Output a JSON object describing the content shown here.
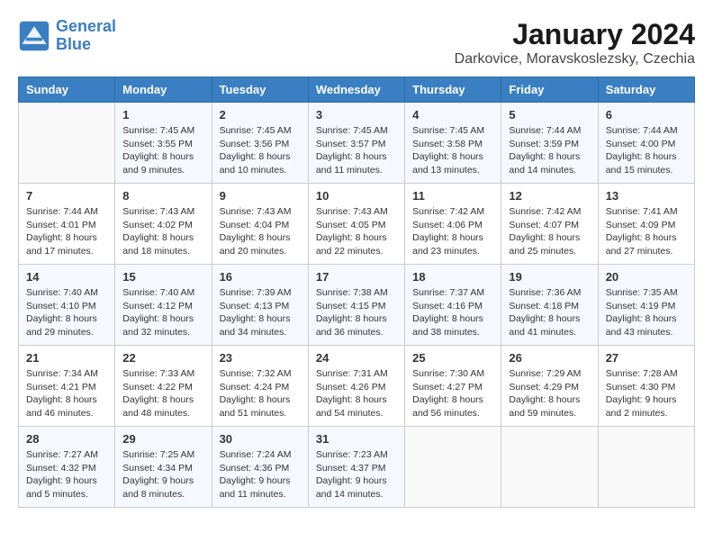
{
  "logo": {
    "line1": "General",
    "line2": "Blue"
  },
  "title": "January 2024",
  "subtitle": "Darkovice, Moravskoslezsky, Czechia",
  "weekdays": [
    "Sunday",
    "Monday",
    "Tuesday",
    "Wednesday",
    "Thursday",
    "Friday",
    "Saturday"
  ],
  "weeks": [
    [
      {
        "day": "",
        "info": ""
      },
      {
        "day": "1",
        "info": "Sunrise: 7:45 AM\nSunset: 3:55 PM\nDaylight: 8 hours\nand 9 minutes."
      },
      {
        "day": "2",
        "info": "Sunrise: 7:45 AM\nSunset: 3:56 PM\nDaylight: 8 hours\nand 10 minutes."
      },
      {
        "day": "3",
        "info": "Sunrise: 7:45 AM\nSunset: 3:57 PM\nDaylight: 8 hours\nand 11 minutes."
      },
      {
        "day": "4",
        "info": "Sunrise: 7:45 AM\nSunset: 3:58 PM\nDaylight: 8 hours\nand 13 minutes."
      },
      {
        "day": "5",
        "info": "Sunrise: 7:44 AM\nSunset: 3:59 PM\nDaylight: 8 hours\nand 14 minutes."
      },
      {
        "day": "6",
        "info": "Sunrise: 7:44 AM\nSunset: 4:00 PM\nDaylight: 8 hours\nand 15 minutes."
      }
    ],
    [
      {
        "day": "7",
        "info": "Sunrise: 7:44 AM\nSunset: 4:01 PM\nDaylight: 8 hours\nand 17 minutes."
      },
      {
        "day": "8",
        "info": "Sunrise: 7:43 AM\nSunset: 4:02 PM\nDaylight: 8 hours\nand 18 minutes."
      },
      {
        "day": "9",
        "info": "Sunrise: 7:43 AM\nSunset: 4:04 PM\nDaylight: 8 hours\nand 20 minutes."
      },
      {
        "day": "10",
        "info": "Sunrise: 7:43 AM\nSunset: 4:05 PM\nDaylight: 8 hours\nand 22 minutes."
      },
      {
        "day": "11",
        "info": "Sunrise: 7:42 AM\nSunset: 4:06 PM\nDaylight: 8 hours\nand 23 minutes."
      },
      {
        "day": "12",
        "info": "Sunrise: 7:42 AM\nSunset: 4:07 PM\nDaylight: 8 hours\nand 25 minutes."
      },
      {
        "day": "13",
        "info": "Sunrise: 7:41 AM\nSunset: 4:09 PM\nDaylight: 8 hours\nand 27 minutes."
      }
    ],
    [
      {
        "day": "14",
        "info": "Sunrise: 7:40 AM\nSunset: 4:10 PM\nDaylight: 8 hours\nand 29 minutes."
      },
      {
        "day": "15",
        "info": "Sunrise: 7:40 AM\nSunset: 4:12 PM\nDaylight: 8 hours\nand 32 minutes."
      },
      {
        "day": "16",
        "info": "Sunrise: 7:39 AM\nSunset: 4:13 PM\nDaylight: 8 hours\nand 34 minutes."
      },
      {
        "day": "17",
        "info": "Sunrise: 7:38 AM\nSunset: 4:15 PM\nDaylight: 8 hours\nand 36 minutes."
      },
      {
        "day": "18",
        "info": "Sunrise: 7:37 AM\nSunset: 4:16 PM\nDaylight: 8 hours\nand 38 minutes."
      },
      {
        "day": "19",
        "info": "Sunrise: 7:36 AM\nSunset: 4:18 PM\nDaylight: 8 hours\nand 41 minutes."
      },
      {
        "day": "20",
        "info": "Sunrise: 7:35 AM\nSunset: 4:19 PM\nDaylight: 8 hours\nand 43 minutes."
      }
    ],
    [
      {
        "day": "21",
        "info": "Sunrise: 7:34 AM\nSunset: 4:21 PM\nDaylight: 8 hours\nand 46 minutes."
      },
      {
        "day": "22",
        "info": "Sunrise: 7:33 AM\nSunset: 4:22 PM\nDaylight: 8 hours\nand 48 minutes."
      },
      {
        "day": "23",
        "info": "Sunrise: 7:32 AM\nSunset: 4:24 PM\nDaylight: 8 hours\nand 51 minutes."
      },
      {
        "day": "24",
        "info": "Sunrise: 7:31 AM\nSunset: 4:26 PM\nDaylight: 8 hours\nand 54 minutes."
      },
      {
        "day": "25",
        "info": "Sunrise: 7:30 AM\nSunset: 4:27 PM\nDaylight: 8 hours\nand 56 minutes."
      },
      {
        "day": "26",
        "info": "Sunrise: 7:29 AM\nSunset: 4:29 PM\nDaylight: 8 hours\nand 59 minutes."
      },
      {
        "day": "27",
        "info": "Sunrise: 7:28 AM\nSunset: 4:30 PM\nDaylight: 9 hours\nand 2 minutes."
      }
    ],
    [
      {
        "day": "28",
        "info": "Sunrise: 7:27 AM\nSunset: 4:32 PM\nDaylight: 9 hours\nand 5 minutes."
      },
      {
        "day": "29",
        "info": "Sunrise: 7:25 AM\nSunset: 4:34 PM\nDaylight: 9 hours\nand 8 minutes."
      },
      {
        "day": "30",
        "info": "Sunrise: 7:24 AM\nSunset: 4:36 PM\nDaylight: 9 hours\nand 11 minutes."
      },
      {
        "day": "31",
        "info": "Sunrise: 7:23 AM\nSunset: 4:37 PM\nDaylight: 9 hours\nand 14 minutes."
      },
      {
        "day": "",
        "info": ""
      },
      {
        "day": "",
        "info": ""
      },
      {
        "day": "",
        "info": ""
      }
    ]
  ]
}
